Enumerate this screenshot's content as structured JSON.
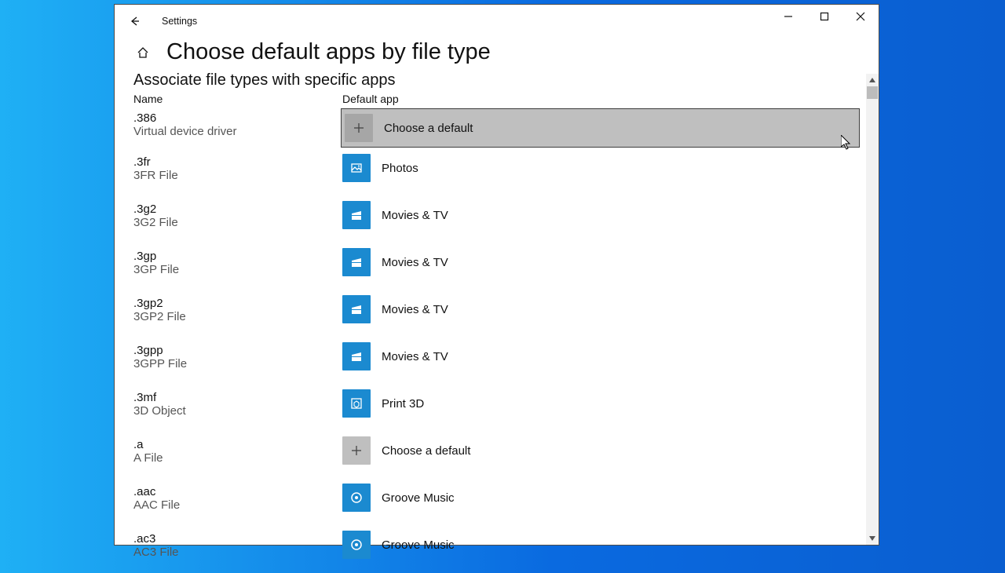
{
  "window": {
    "title": "Settings"
  },
  "header": {
    "page_title": "Choose default apps by file type",
    "subheader": "Associate file types with specific apps",
    "col_name": "Name",
    "col_app": "Default app"
  },
  "apps": {
    "choose": "Choose a default",
    "photos": "Photos",
    "moviestv": "Movies & TV",
    "print3d": "Print 3D",
    "groove": "Groove Music"
  },
  "rows": [
    {
      "ext": ".386",
      "desc": "Virtual device driver",
      "app": "choose",
      "icon": "plus",
      "selected": true
    },
    {
      "ext": ".3fr",
      "desc": "3FR File",
      "app": "photos",
      "icon": "photos",
      "selected": false
    },
    {
      "ext": ".3g2",
      "desc": "3G2 File",
      "app": "moviestv",
      "icon": "movies",
      "selected": false
    },
    {
      "ext": ".3gp",
      "desc": "3GP File",
      "app": "moviestv",
      "icon": "movies",
      "selected": false
    },
    {
      "ext": ".3gp2",
      "desc": "3GP2 File",
      "app": "moviestv",
      "icon": "movies",
      "selected": false
    },
    {
      "ext": ".3gpp",
      "desc": "3GPP File",
      "app": "moviestv",
      "icon": "movies",
      "selected": false
    },
    {
      "ext": ".3mf",
      "desc": "3D Object",
      "app": "print3d",
      "icon": "print3d",
      "selected": false
    },
    {
      "ext": ".a",
      "desc": "A File",
      "app": "choose",
      "icon": "plus",
      "selected": false
    },
    {
      "ext": ".aac",
      "desc": "AAC File",
      "app": "groove",
      "icon": "groove",
      "selected": false
    },
    {
      "ext": ".ac3",
      "desc": "AC3 File",
      "app": "groove",
      "icon": "groove",
      "selected": false
    }
  ]
}
